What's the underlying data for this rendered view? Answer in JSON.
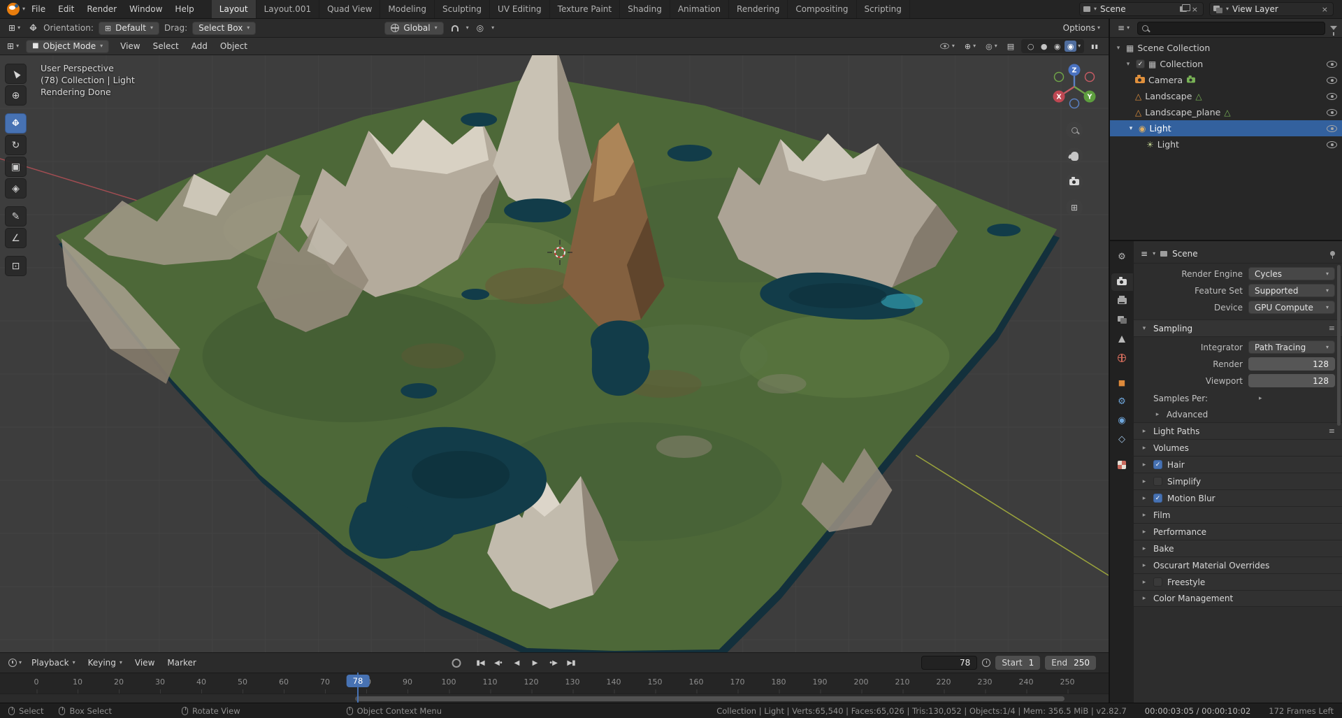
{
  "icons": {
    "caret": "▾",
    "collapse": "▾",
    "expand": "▸",
    "check": "✓",
    "close": "×",
    "menu": "≡",
    "grid": "⊞",
    "crosshair": "⊕",
    "rotate_tool": "↻",
    "scale_tool": "▣",
    "transform_tool": "◈",
    "annotate_tool": "✎",
    "measure_tool": "∠",
    "cube_tool": "⊡",
    "play": "▶",
    "play_rev": "◀",
    "bar": "▮",
    "dot": "•",
    "pause": "▮▮",
    "prop_edit": "◎",
    "xray": "▤",
    "overlays": "◎",
    "gizmos": "⊕",
    "sun": "☀",
    "light": "◉",
    "mesh": "△",
    "box": "▦",
    "object_square": "■",
    "gear": "⚙",
    "constraint": "◇",
    "wire_circle": "○",
    "solid_circle": "●",
    "mat_circle": "◉",
    "rend_circle": "◉"
  },
  "topbar": {
    "menus": [
      "File",
      "Edit",
      "Render",
      "Window",
      "Help"
    ],
    "workspaces": [
      "Layout",
      "Layout.001",
      "Quad View",
      "Modeling",
      "Sculpting",
      "UV Editing",
      "Texture Paint",
      "Shading",
      "Animation",
      "Rendering",
      "Compositing",
      "Scripting"
    ],
    "active_workspace": "Layout",
    "scene_name": "Scene",
    "view_layer_name": "View Layer"
  },
  "tool_settings": {
    "orientation_label": "Orientation:",
    "orientation": "Default",
    "drag_label": "Drag:",
    "drag": "Select Box",
    "transform_space": "Global",
    "options": "Options"
  },
  "viewport": {
    "mode": "Object Mode",
    "menus": [
      "View",
      "Select",
      "Add",
      "Object"
    ],
    "overlay": {
      "line1": "User Perspective",
      "line2": "(78) Collection | Light",
      "line3": "Rendering Done"
    },
    "gizmo": {
      "x": "X",
      "y": "Y",
      "z": "Z"
    }
  },
  "outliner": {
    "rows": [
      {
        "label": "Scene Collection"
      },
      {
        "label": "Collection"
      },
      {
        "label": "Camera"
      },
      {
        "label": "Landscape"
      },
      {
        "label": "Landscape_plane"
      },
      {
        "label": "Light",
        "selected": true
      },
      {
        "label": "Light"
      }
    ]
  },
  "properties": {
    "breadcrumb": "Scene",
    "render_engine_label": "Render Engine",
    "render_engine": "Cycles",
    "feature_set_label": "Feature Set",
    "feature_set": "Supported",
    "device_label": "Device",
    "device": "GPU Compute",
    "sampling_title": "Sampling",
    "integrator_label": "Integrator",
    "integrator": "Path Tracing",
    "render_label": "Render",
    "render_samples": "128",
    "viewport_label": "Viewport",
    "viewport_samples": "128",
    "samples_per": "Samples Per:",
    "advanced": "Advanced",
    "panels": [
      "Light Paths",
      "Volumes",
      "Hair",
      "Simplify",
      "Motion Blur",
      "Film",
      "Performance",
      "Bake",
      "Oscurart Material Overrides",
      "Freestyle",
      "Color Management"
    ]
  },
  "timeline": {
    "menus": [
      "Playback",
      "Keying",
      "View",
      "Marker"
    ],
    "current_frame": "78",
    "playhead_label": "78",
    "start_label": "Start",
    "start_value": "1",
    "end_label": "End",
    "end_value": "250",
    "ticks": [
      "0",
      "10",
      "20",
      "30",
      "40",
      "50",
      "60",
      "70",
      "80",
      "90",
      "100",
      "110",
      "120",
      "130",
      "140",
      "150",
      "160",
      "170",
      "180",
      "190",
      "200",
      "210",
      "220",
      "230",
      "240",
      "250"
    ]
  },
  "statusbar": {
    "hints": [
      "Select",
      "Box Select",
      "Rotate View",
      "Object Context Menu"
    ],
    "stats": "Collection | Light | Verts:65,540 | Faces:65,026 | Tris:130,052 | Objects:1/4 | Mem: 356.5 MiB | v2.82.7",
    "timecode": "00:00:03:05 / 00:00:10:02",
    "frames_left": "172 Frames Left"
  },
  "colors": {
    "accent": "#4772b3",
    "selection": "#33619e",
    "viewport_bg": "#3d3d3d"
  }
}
